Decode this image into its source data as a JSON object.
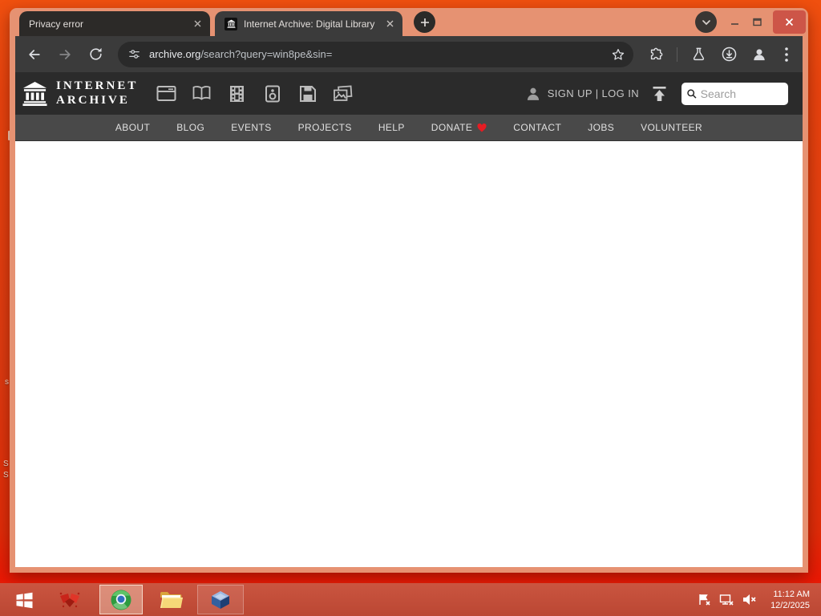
{
  "colors": {
    "desktop_orange": "#e8430e",
    "window_frame_salmon": "#e69272",
    "close_button_red": "#cd5548",
    "toolbar_dark": "#3b3b3b",
    "omnibox_dark": "#2a2a2a",
    "page_header_dark": "#2b2b2b",
    "nav_gray": "#494949",
    "taskbar_red": "#c24e36",
    "donate_heart_red": "#e51c23"
  },
  "browser": {
    "tabs": [
      {
        "title": "Privacy error",
        "active": false
      },
      {
        "title": "Internet Archive: Digital Library",
        "active": true
      }
    ],
    "url_domain": "archive.org",
    "url_path": "/search?query=win8pe&sin="
  },
  "archive": {
    "logo_line1": "INTERNET",
    "logo_line2": "ARCHIVE",
    "auth_text": "SIGN UP | LOG IN",
    "search_placeholder": "Search",
    "nav": [
      "ABOUT",
      "BLOG",
      "EVENTS",
      "PROJECTS",
      "HELP",
      "DONATE",
      "CONTACT",
      "JOBS",
      "VOLUNTEER"
    ]
  },
  "taskbar": {
    "time": "11:12 AM",
    "date": "12/2/2025"
  },
  "desktop": {
    "fragments": [
      "s",
      "S",
      "S"
    ]
  },
  "icons": {
    "tab_favicon": "internet-archive-icon",
    "window_controls": [
      "tab-search-chevron-icon",
      "minimize-icon",
      "maximize-icon",
      "close-icon"
    ],
    "toolbar": [
      "back-arrow-icon",
      "forward-arrow-icon",
      "reload-icon",
      "site-settings-icon",
      "bookmark-star-icon",
      "extensions-puzzle-icon",
      "labs-flask-icon",
      "downloads-icon",
      "profile-icon",
      "menu-kebab-icon"
    ],
    "media_types": [
      "web-icon",
      "texts-icon",
      "video-icon",
      "audio-icon",
      "software-icon",
      "images-icon"
    ],
    "header": [
      "person-icon",
      "upload-icon",
      "search-magnifier-icon",
      "heart-icon"
    ],
    "taskbar_apps": [
      "start-icon",
      "red-x-app-icon",
      "browser-app-icon",
      "file-explorer-icon",
      "virtualbox-icon"
    ],
    "tray": [
      "action-center-flag-icon",
      "network-disconnected-icon",
      "volume-muted-icon"
    ]
  }
}
